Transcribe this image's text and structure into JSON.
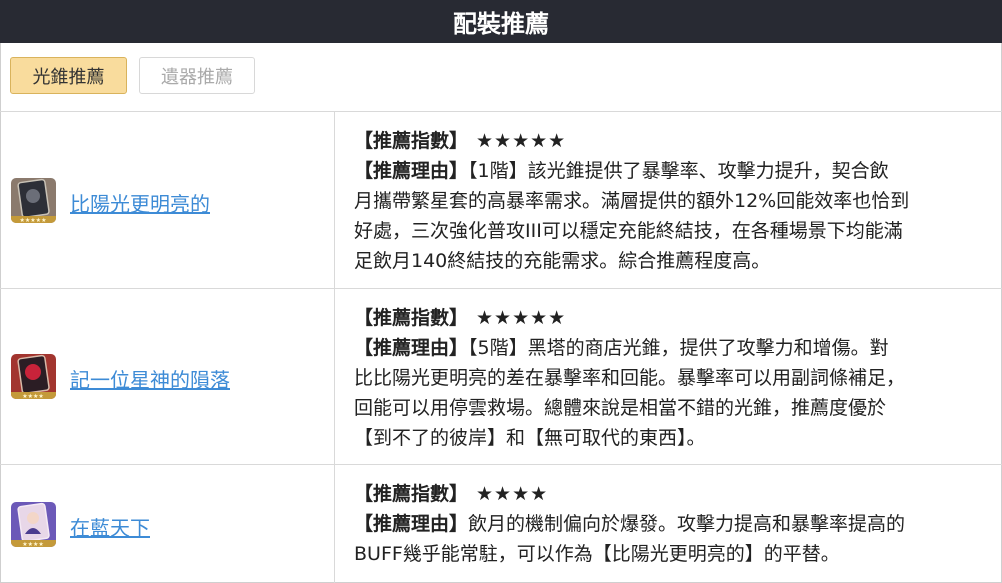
{
  "header": {
    "title": "配裝推薦"
  },
  "tabs": [
    {
      "label": "光錐推薦",
      "active": true
    },
    {
      "label": "遺器推薦",
      "active": false
    }
  ],
  "rows": [
    {
      "name": "比陽光更明亮的",
      "thumb_colors": [
        "#8b7a6d",
        "#2d2f37"
      ],
      "rating_label": "【推薦指數】",
      "stars": "★★★★★",
      "reason_label": "【推薦理由】",
      "reason_lines": [
        "【1階】該光錐提供了暴擊率、攻擊力提升，契合飲",
        "月攜帶繁星套的高暴率需求。滿層提供的額外12%回能效率也恰到",
        "好處，三次強化普攻III可以穩定充能終結技，在各種場景下均能滿",
        "足飲月140終結技的充能需求。綜合推薦程度高。"
      ]
    },
    {
      "name": "記一位星神的隕落",
      "thumb_colors": [
        "#a2352f",
        "#2b1d24"
      ],
      "rating_label": "【推薦指數】",
      "stars": "★★★★★",
      "reason_label": "【推薦理由】",
      "reason_lines": [
        "【5階】黑塔的商店光錐，提供了攻擊力和增傷。對",
        "比比陽光更明亮的差在暴擊率和回能。暴擊率可以用副詞條補足，",
        "回能可以用停雲救場。總體來說是相當不錯的光錐，推薦度優於",
        "【到不了的彼岸】和【無可取代的東西】。"
      ]
    },
    {
      "name": "在藍天下",
      "thumb_colors": [
        "#6c59b8",
        "#e8d7e8"
      ],
      "rating_label": "【推薦指數】",
      "stars": "★★★★",
      "reason_label": "【推薦理由】",
      "reason_lines": [
        "飲月的機制偏向於爆發。攻擊力提高和暴擊率提高的",
        "BUFF幾乎能常駐，可以作為【比陽光更明亮的】的平替。"
      ]
    }
  ]
}
